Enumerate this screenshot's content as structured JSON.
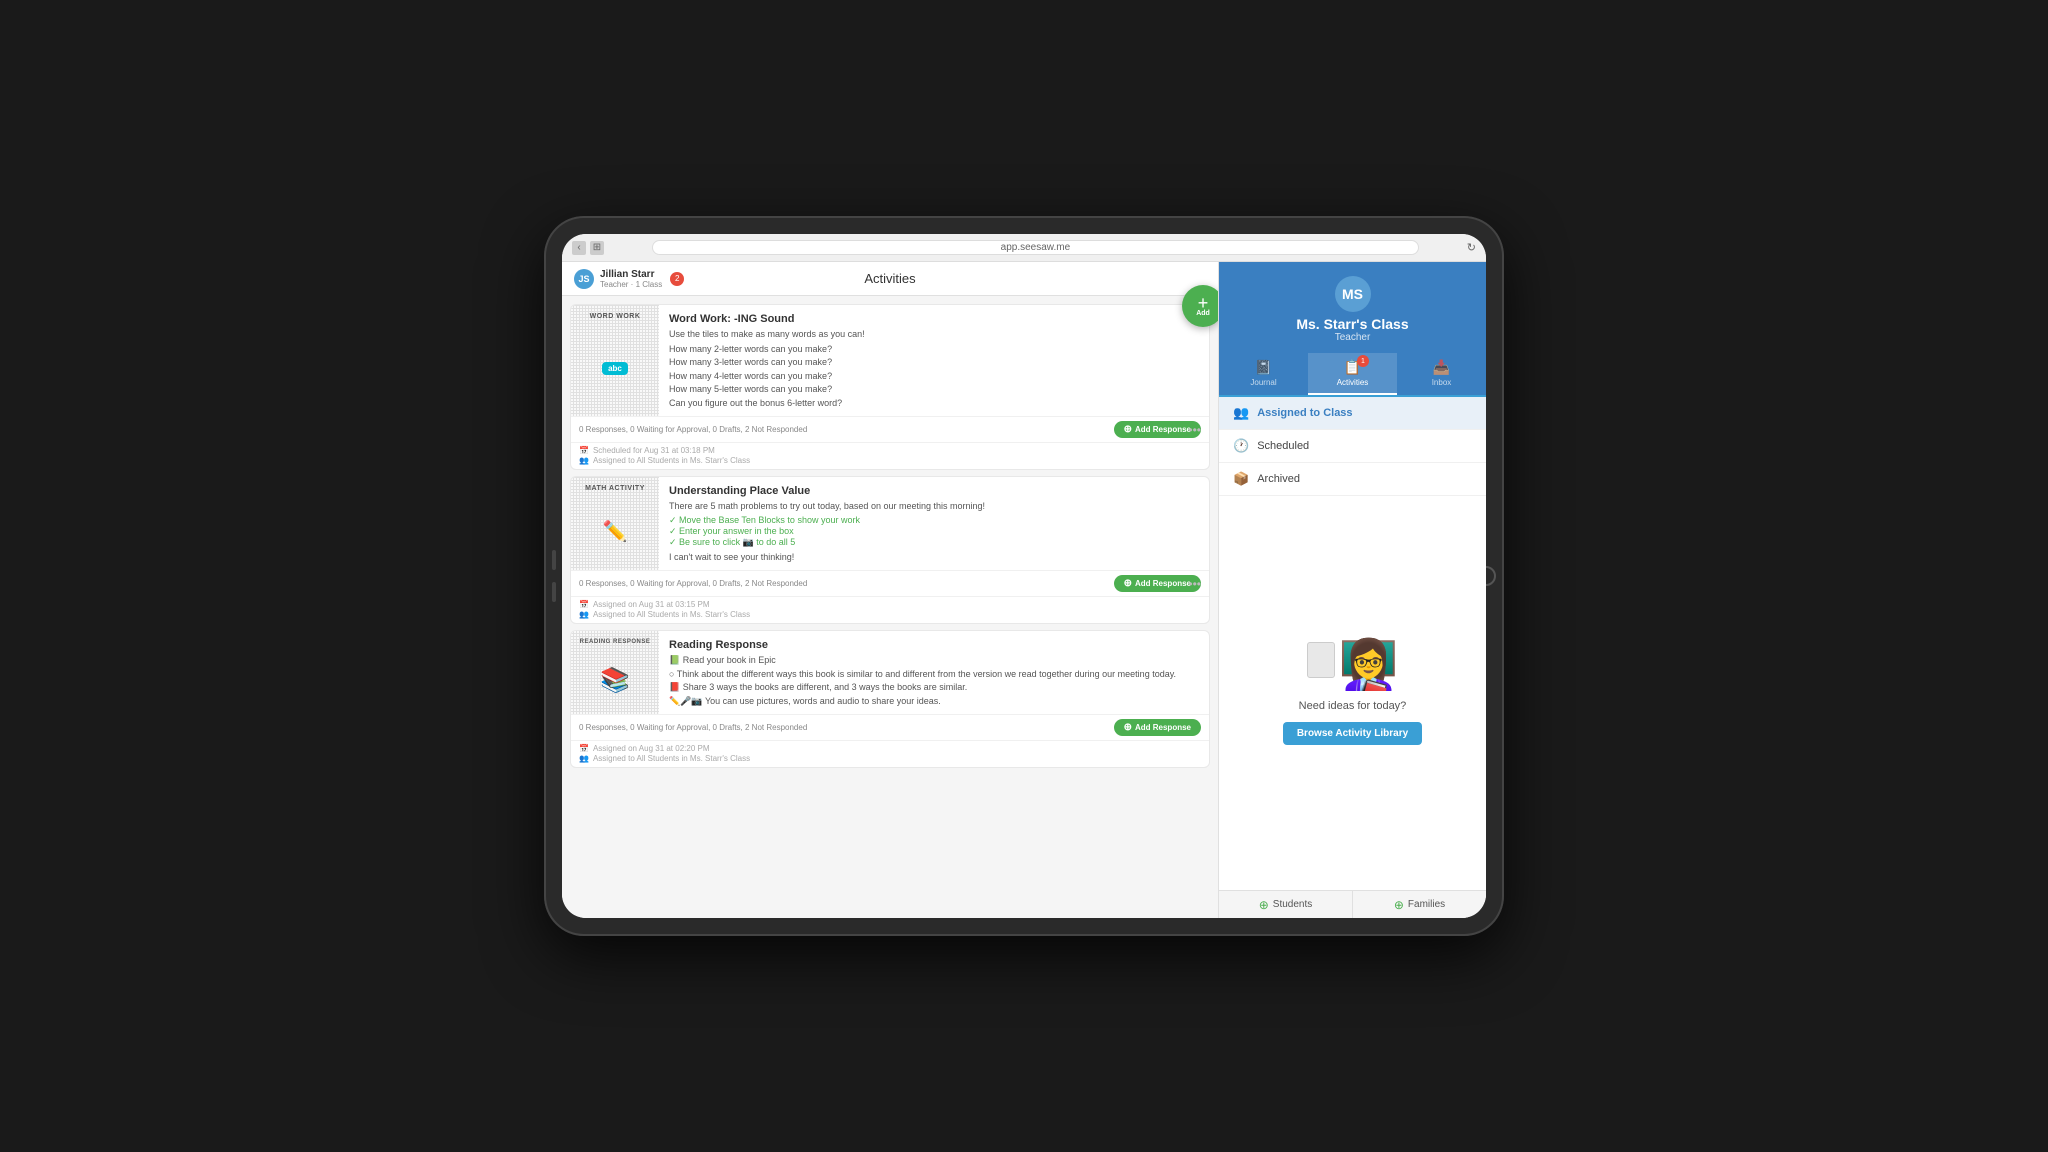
{
  "browser": {
    "url": "app.seesaw.me",
    "nav_back": "‹",
    "nav_grid": "⊞",
    "reload": "↻"
  },
  "header": {
    "title": "Activities",
    "user_name": "Jillian Starr",
    "user_role": "Teacher · 1 Class",
    "notification_count": "2",
    "add_label": "Add"
  },
  "activities": [
    {
      "id": 1,
      "title": "Word Work: -ING Sound",
      "thumbnail_type": "word-work",
      "thumbnail_label": "WORD WORK",
      "thumbnail_sublabel": "abc",
      "description": "Use the tiles to make as many words as you can!",
      "items": [
        "How many 2-letter words can you make?",
        "How many 3-letter words can you make?",
        "How many 4-letter words can you make?",
        "How many 5-letter words can you make?",
        "Can you figure out the bonus 6-letter word?"
      ],
      "stats": "0 Responses, 0 Waiting for Approval, 0 Drafts, 2 Not Responded",
      "add_response": "Add Response",
      "scheduled": "Scheduled for Aug 31 at 03:18 PM",
      "assigned": "Assigned to All Students in Ms. Starr's Class"
    },
    {
      "id": 2,
      "title": "Understanding Place Value",
      "thumbnail_type": "math",
      "thumbnail_label": "MATH ACTIVITY",
      "description": "There are 5 math problems to try out today, based on our meeting this morning!",
      "items": [
        "✓ Move the Base Ten Blocks to show your work",
        "✓ Enter your answer in the box",
        "✓ Be sure to click 📷 to do all 5"
      ],
      "extra": "I can't wait to see your thinking!",
      "stats": "0 Responses, 0 Waiting for Approval, 0 Drafts, 2 Not Responded",
      "add_response": "Add Response",
      "scheduled": "Assigned on Aug 31 at 03:15 PM",
      "assigned": "Assigned to All Students in Ms. Starr's Class"
    },
    {
      "id": 3,
      "title": "Reading Response",
      "thumbnail_type": "reading",
      "thumbnail_label": "READING RESPONSE",
      "description_items": [
        "📗 Read your book in Epic",
        "○ Think about the different ways this book is similar to and different from the version we read together during our meeting today.",
        "📕 Share 3 ways the books are different, and 3 ways the books are similar.",
        "✏️🎤📷 You can use pictures, words and audio to share your ideas."
      ],
      "stats": "0 Responses, 0 Waiting for Approval, 0 Drafts, 2 Not Responded",
      "add_response": "Add Response",
      "scheduled": "Assigned on Aug 31 at 02:20 PM",
      "assigned": "Assigned to All Students in Ms. Starr's Class"
    }
  ],
  "right_panel": {
    "class_initials": "MS",
    "class_name": "Ms. Starr's Class",
    "class_role": "Teacher",
    "nav_tabs": [
      {
        "icon": "📓",
        "label": "Journal",
        "active": false
      },
      {
        "icon": "📋",
        "label": "Activities",
        "active": true,
        "badge": "1"
      },
      {
        "icon": "📥",
        "label": "Inbox",
        "active": false
      }
    ],
    "sidebar_items": [
      {
        "icon": "👥",
        "label": "Assigned to Class",
        "active": true
      },
      {
        "icon": "🕐",
        "label": "Scheduled",
        "active": false
      },
      {
        "icon": "📦",
        "label": "Archived",
        "active": false
      }
    ],
    "ideas_prompt": "Need ideas for today?",
    "browse_btn": "Browse Activity Library",
    "bottom_btns": [
      {
        "icon": "⊕",
        "label": "Students"
      },
      {
        "icon": "⊕",
        "label": "Families"
      }
    ]
  }
}
